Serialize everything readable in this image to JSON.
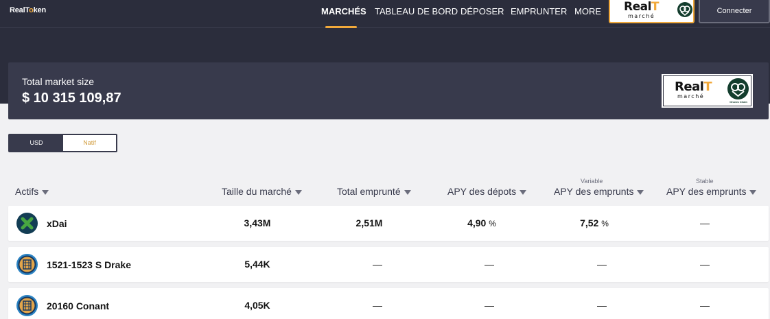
{
  "header": {
    "logo_text_a": "RealT",
    "logo_text_o": "o",
    "logo_text_b": "ken",
    "nav": [
      "MARCHÉS",
      "TABLEAU DE BORD",
      "DÉPOSER",
      "EMPRUNTER",
      "MORE"
    ],
    "market_logo": {
      "real": "Real",
      "t": "T",
      "sub": "marché"
    },
    "connect_label": "Connecter"
  },
  "summary": {
    "label": "Total market size",
    "value": "$ 10 315 109,87",
    "badge": {
      "real": "Real",
      "t": "T",
      "sub": "marché",
      "chain": "Gnosis Chain"
    }
  },
  "toggle": {
    "usd": "USD",
    "native": "Natif",
    "selected": "Natif"
  },
  "table": {
    "headers": {
      "asset": "Actifs",
      "market_size": "Taille du marché",
      "total_borrowed": "Total emprunté",
      "deposit_apy": "APY des dépots",
      "variable_label": "Variable",
      "variable_apy": "APY des emprunts",
      "stable_label": "Stable",
      "stable_apy": "APY des emprunts"
    },
    "rows": [
      {
        "name": "xDai",
        "icon": "xdai-icon",
        "market_size": "3,43M",
        "borrowed": "2,51M",
        "deposit_apy": "4,90",
        "deposit_pct": "%",
        "variable_apy": "7,52",
        "variable_pct": "%",
        "stable_apy": "—"
      },
      {
        "name": "1521-1523 S Drake",
        "icon": "property-token-icon",
        "market_size": "5,44K",
        "borrowed": "—",
        "deposit_apy": "—",
        "variable_apy": "—",
        "stable_apy": "—"
      },
      {
        "name": "20160 Conant",
        "icon": "property-token-icon",
        "market_size": "4,05K",
        "borrowed": "—",
        "deposit_apy": "—",
        "variable_apy": "—",
        "stable_apy": "—"
      }
    ]
  },
  "colors": {
    "accent": "#f1a93b",
    "navy": "#2b2d3c",
    "panel": "#383a4c",
    "xdai_green": "#48a641"
  }
}
